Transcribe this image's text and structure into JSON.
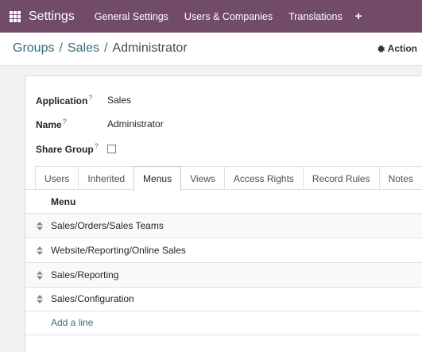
{
  "navbar": {
    "app_title": "Settings",
    "menu_items": [
      "General Settings",
      "Users & Companies",
      "Translations"
    ],
    "plus_label": "+"
  },
  "breadcrumb": {
    "items": [
      "Groups",
      "Sales",
      "Administrator"
    ],
    "separator": "/"
  },
  "action": {
    "label": "Action"
  },
  "form": {
    "application": {
      "label": "Application",
      "help": "?",
      "value": "Sales"
    },
    "name": {
      "label": "Name",
      "help": "?",
      "value": "Administrator"
    },
    "share_group": {
      "label": "Share Group",
      "help": "?",
      "checked": false
    }
  },
  "tabs": {
    "items": [
      "Users",
      "Inherited",
      "Menus",
      "Views",
      "Access Rights",
      "Record Rules",
      "Notes"
    ],
    "active": "Menus"
  },
  "table": {
    "column": "Menu",
    "rows": [
      "Sales/Orders/Sales Teams",
      "Website/Reporting/Online Sales",
      "Sales/Reporting",
      "Sales/Configuration"
    ],
    "add_line": "Add a line"
  },
  "colors": {
    "navbar": "#714b67",
    "link": "#35707b"
  }
}
